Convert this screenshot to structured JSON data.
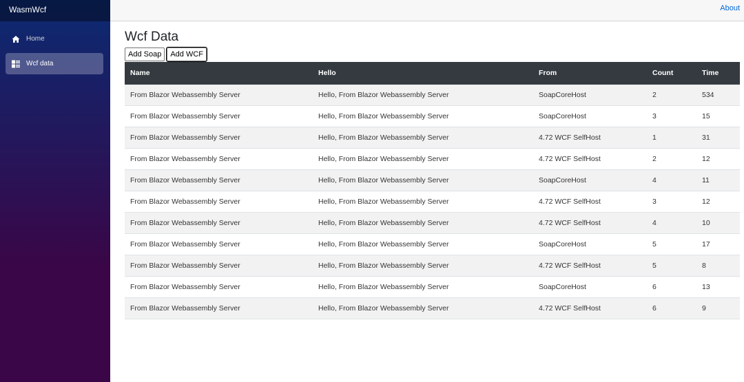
{
  "brand": {
    "title": "WasmWcf"
  },
  "sidebar": {
    "items": [
      {
        "label": "Home",
        "icon": "home-icon",
        "active": false
      },
      {
        "label": "Wcf data",
        "icon": "list-icon",
        "active": true
      }
    ]
  },
  "topbar": {
    "about_label": "About"
  },
  "page": {
    "title": "Wcf Data"
  },
  "buttons": {
    "add_soap": "Add Soap",
    "add_wcf": "Add WCF"
  },
  "table": {
    "columns": [
      "Name",
      "Hello",
      "From",
      "Count",
      "Time"
    ],
    "rows": [
      [
        "From Blazor Webassembly Server",
        "Hello, From Blazor Webassembly Server",
        "SoapCoreHost",
        "2",
        "534"
      ],
      [
        "From Blazor Webassembly Server",
        "Hello, From Blazor Webassembly Server",
        "SoapCoreHost",
        "3",
        "15"
      ],
      [
        "From Blazor Webassembly Server",
        "Hello, From Blazor Webassembly Server",
        "4.72 WCF SelfHost",
        "1",
        "31"
      ],
      [
        "From Blazor Webassembly Server",
        "Hello, From Blazor Webassembly Server",
        "4.72 WCF SelfHost",
        "2",
        "12"
      ],
      [
        "From Blazor Webassembly Server",
        "Hello, From Blazor Webassembly Server",
        "SoapCoreHost",
        "4",
        "11"
      ],
      [
        "From Blazor Webassembly Server",
        "Hello, From Blazor Webassembly Server",
        "4.72 WCF SelfHost",
        "3",
        "12"
      ],
      [
        "From Blazor Webassembly Server",
        "Hello, From Blazor Webassembly Server",
        "4.72 WCF SelfHost",
        "4",
        "10"
      ],
      [
        "From Blazor Webassembly Server",
        "Hello, From Blazor Webassembly Server",
        "SoapCoreHost",
        "5",
        "17"
      ],
      [
        "From Blazor Webassembly Server",
        "Hello, From Blazor Webassembly Server",
        "4.72 WCF SelfHost",
        "5",
        "8"
      ],
      [
        "From Blazor Webassembly Server",
        "Hello, From Blazor Webassembly Server",
        "SoapCoreHost",
        "6",
        "13"
      ],
      [
        "From Blazor Webassembly Server",
        "Hello, From Blazor Webassembly Server",
        "4.72 WCF SelfHost",
        "6",
        "9"
      ]
    ]
  },
  "colors": {
    "sidebar_top": "#0b2a72",
    "sidebar_bottom": "#3a0647",
    "table_header": "#343a40",
    "link": "#0366d6"
  }
}
